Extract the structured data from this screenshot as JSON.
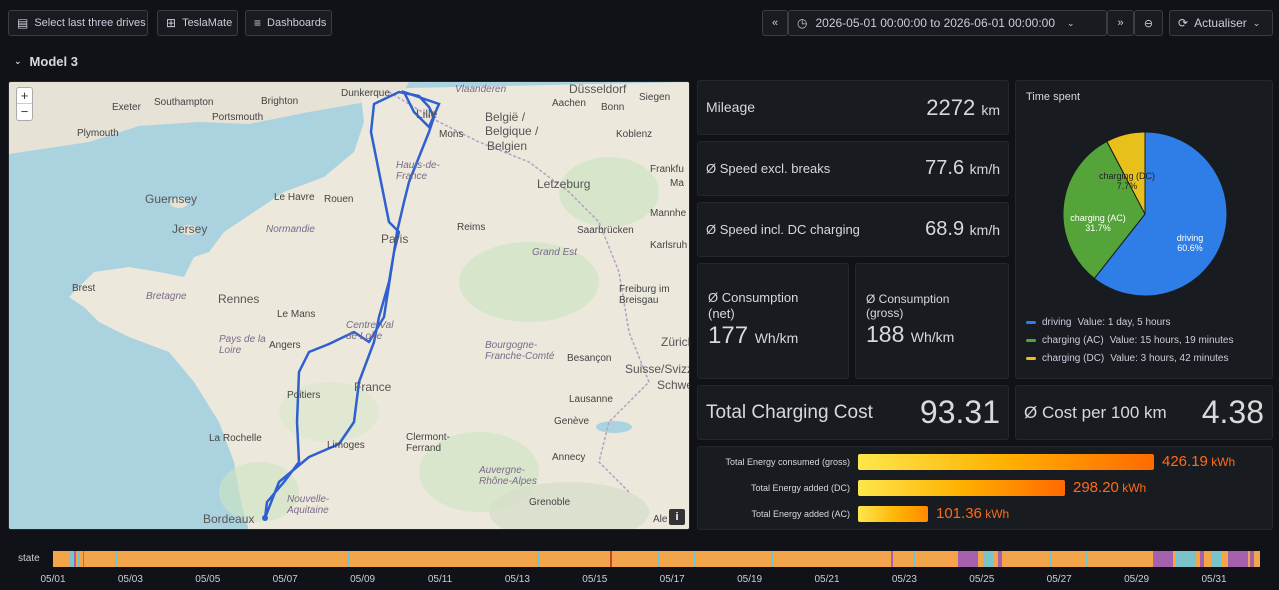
{
  "toolbar": {
    "select_drives_label": "Select last three drives",
    "teslamate_label": "TeslaMate",
    "dashboards_label": "Dashboards",
    "time_range": "2026-05-01 00:00:00 to 2026-06-01 00:00:00",
    "refresh_label": "Actualiser"
  },
  "row_title": "Model 3",
  "map": {
    "zoom_in": "+",
    "zoom_out": "−",
    "info": "i",
    "labels": [
      "Exeter",
      "Southampton",
      "Brighton",
      "Plymouth",
      "Portsmouth",
      "Dunkerque",
      "Vlaanderen",
      "Düsseldorf",
      "Aachen",
      "Bonn",
      "Siegen",
      "Lille",
      "Mons",
      "België /",
      "Belgique /",
      "Belgien",
      "Koblenz",
      "Frankfu",
      "Ma",
      "Guernsey",
      "Jersey",
      "Le Havre",
      "Rouen",
      "Normandie",
      "Hauts-de-France",
      "Letzeburg",
      "Mannhe",
      "Saarbrücken",
      "Karlsruh",
      "Reims",
      "Paris",
      "Grand Est",
      "Brest",
      "Bretagne",
      "Rennes",
      "Le Mans",
      "Freiburg im Breisgau",
      "Zürich",
      "Angers",
      "Pays de la Loire",
      "Centre-Val de Loire",
      "Bourgogne-Franche-Comté",
      "Besançon",
      "Suisse/Svizz",
      "Schwei",
      "France",
      "Lausanne",
      "Poitiers",
      "Genève",
      "La Rochelle",
      "Limoges",
      "Clermont-Ferrand",
      "Annecy",
      "Auvergne-Rhône-Alpes",
      "Grenoble",
      "Nouvelle-Aquitaine",
      "Bordeaux",
      "Ale"
    ]
  },
  "stats": {
    "mileage": {
      "label": "Mileage",
      "value": "2272",
      "unit": "km"
    },
    "speed_excl": {
      "label": "Ø Speed excl. breaks",
      "value": "77.6",
      "unit": "km/h"
    },
    "speed_incl": {
      "label": "Ø Speed incl. DC charging",
      "value": "68.9",
      "unit": "km/h"
    },
    "cons_net": {
      "label_1": "Ø Consumption",
      "label_2": "(net)",
      "value": "177",
      "unit": "Wh/km"
    },
    "cons_gross": {
      "label_1": "Ø Consumption",
      "label_2": "(gross)",
      "value": "188",
      "unit": "Wh/km"
    },
    "total_cost": {
      "label": "Total Charging Cost",
      "value": "93.31"
    },
    "cost_100": {
      "label": "Ø Cost per 100 km",
      "value": "4.38"
    }
  },
  "time_spent": {
    "title": "Time spent",
    "slice_labels": {
      "driving": "driving",
      "driving_pct": "60.6%",
      "ac": "charging (AC)",
      "ac_pct": "31.7%",
      "dc": "charging (DC)",
      "dc_pct": "7.7%"
    },
    "legend": [
      {
        "name": "driving",
        "text": "Value: 1 day, 5 hours"
      },
      {
        "name": "charging (AC)",
        "text": "Value: 15 hours, 19 minutes"
      },
      {
        "name": "charging (DC)",
        "text": "Value: 3 hours, 42 minutes"
      }
    ],
    "colors": {
      "driving": "#2f7de6",
      "ac": "#54a43a",
      "dc": "#e8c01b"
    }
  },
  "chart_data": {
    "type": "pie",
    "title": "Time spent",
    "categories": [
      "driving",
      "charging (AC)",
      "charging (DC)"
    ],
    "values": [
      60.6,
      31.7,
      7.7
    ]
  },
  "energy": {
    "rows": [
      {
        "label": "Total Energy consumed (gross)",
        "value": "426.19",
        "unit": "kWh",
        "amount": 426.19
      },
      {
        "label": "Total Energy added (DC)",
        "value": "298.20",
        "unit": "kWh",
        "amount": 298.2
      },
      {
        "label": "Total Energy added (AC)",
        "value": "101.36",
        "unit": "kWh",
        "amount": 101.36
      }
    ]
  },
  "state": {
    "label": "state",
    "ticks": [
      "05/01",
      "05/03",
      "05/05",
      "05/07",
      "05/09",
      "05/11",
      "05/13",
      "05/15",
      "05/17",
      "05/19",
      "05/21",
      "05/23",
      "05/25",
      "05/27",
      "05/29",
      "05/31"
    ]
  }
}
